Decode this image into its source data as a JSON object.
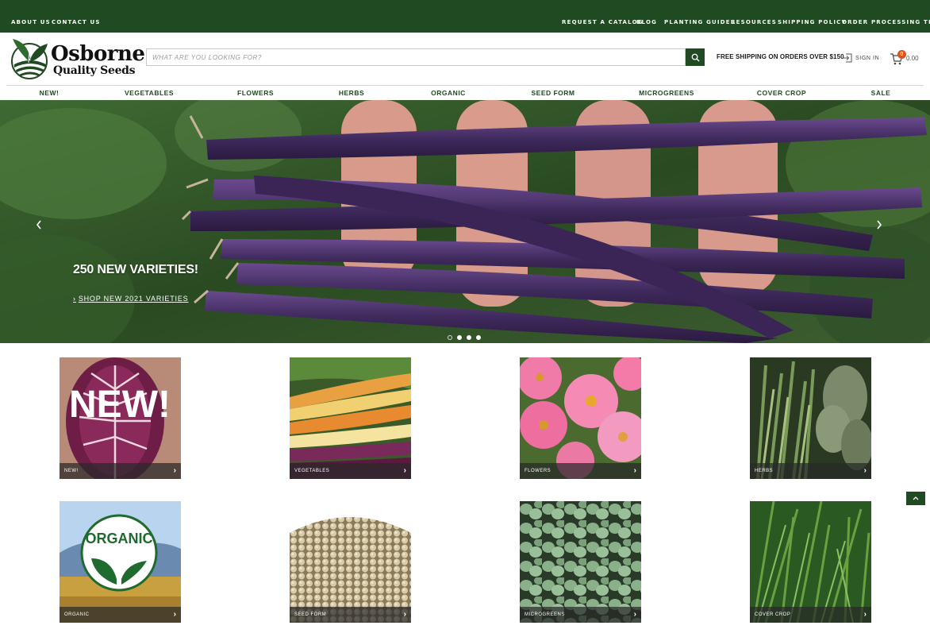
{
  "topbar": {
    "left": [
      "ABOUT US",
      "CONTACT US"
    ],
    "right": [
      "REQUEST A CATALOG",
      "BLOG",
      "PLANTING GUIDES",
      "RESOURCES",
      "SHIPPING POLICY",
      "ORDER PROCESSING TIME"
    ]
  },
  "header": {
    "logo_line1": "Osborne",
    "logo_line2": "Quality Seeds",
    "search_placeholder": "WHAT ARE YOU LOOKING FOR?",
    "shipping": "FREE SHIPPING ON ORDERS OVER $150",
    "sign_in": "SIGN IN",
    "cart_count": "0",
    "cart_total": "0.00"
  },
  "nav": [
    "NEW!",
    "VEGETABLES",
    "FLOWERS",
    "HERBS",
    "ORGANIC",
    "SEED FORM",
    "MICROGREENS",
    "COVER CROP",
    "SALE"
  ],
  "hero": {
    "title": "250 NEW VARIETIES!",
    "link": "SHOP NEW 2021 VARIETIES",
    "slides": 4,
    "active_slide": 1
  },
  "categories": [
    {
      "label": "NEW!",
      "overlay": "NEW!"
    },
    {
      "label": "VEGETABLES"
    },
    {
      "label": "FLOWERS"
    },
    {
      "label": "HERBS"
    },
    {
      "label": "ORGANIC",
      "overlay": "ORGANIC"
    },
    {
      "label": "SEED FORM"
    },
    {
      "label": "MICROGREENS"
    },
    {
      "label": "COVER CROP"
    }
  ],
  "colors": {
    "brand_green": "#1f4a22",
    "cart_badge": "#e0501a"
  },
  "icons": {
    "search": "search-icon",
    "sign_in": "sign-in-icon",
    "cart": "cart-icon",
    "prev": "chevron-left-icon",
    "next": "chevron-right-icon",
    "back_to_top": "chevron-up-icon"
  }
}
